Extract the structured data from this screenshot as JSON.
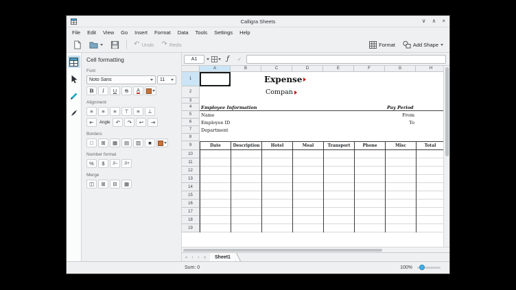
{
  "titlebar": {
    "title": "Calligra Sheets",
    "minimize": "∨",
    "maximize": "∧",
    "close": "×"
  },
  "menu": {
    "items": [
      "File",
      "Edit",
      "View",
      "Go",
      "Insert",
      "Format",
      "Data",
      "Tools",
      "Settings",
      "Help"
    ]
  },
  "toolbar": {
    "undo": "Undo",
    "redo": "Redo",
    "undo_icon": "↶",
    "redo_icon": "↷",
    "format": "Format",
    "add_shape": "Add Shape"
  },
  "panel": {
    "title": "Cell formatting",
    "font_label": "Font",
    "font_family": "Noto Sans",
    "font_size": "11",
    "bold": "B",
    "italic": "I",
    "underline": "U",
    "strike": "S",
    "font_color": "A",
    "alignment_label": "Alignment",
    "align_left": "≡",
    "align_center": "≡",
    "align_right": "≡",
    "align_top": "⊤",
    "align_middle": "≡",
    "align_bottom": "⊥",
    "indent_less": "⇤",
    "indent_more": "⇥",
    "angle_label": "Angle",
    "rotate_ccw": "↶",
    "rotate_cw": "↷",
    "wrap": "↩",
    "borders_label": "Borders",
    "border_icons": [
      "□",
      "⊞",
      "▦",
      "▤",
      "▥",
      "■"
    ],
    "number_label": "Number format",
    "percent": "%",
    "money": "$",
    "precision_less": ".0−",
    "precision_more": ".0+",
    "merge_label": "Merge",
    "merge_icons": [
      "◫",
      "⊞",
      "⊟",
      "▦"
    ]
  },
  "formula_bar": {
    "cell_ref": "A1",
    "fx": "ƒ",
    "apply": "✓"
  },
  "grid": {
    "columns": [
      "A",
      "B",
      "C",
      "D",
      "E",
      "F",
      "G",
      "H"
    ],
    "rows": [
      "1",
      "2",
      "3",
      "4",
      "5",
      "6",
      "7",
      "8",
      "9",
      "10",
      "11",
      "12",
      "13",
      "14",
      "15",
      "16",
      "17",
      "18",
      "19"
    ],
    "content": {
      "title": "Expense",
      "subtitle": "Compan",
      "employee_information": "Employee Information",
      "pay_period": "Pay Period",
      "name": "Name",
      "from": "From",
      "employee_id": "Employee ID",
      "to": "To",
      "department": "Department",
      "table_headers": [
        "Date",
        "Description",
        "Hotel",
        "Meal",
        "Transport",
        "Phone",
        "Misc",
        "Total"
      ]
    }
  },
  "tabbar": {
    "nav": [
      "«",
      "‹",
      "›",
      "»"
    ],
    "sheet_tab": "Sheet1"
  },
  "statusbar": {
    "sum": "Sum: 0",
    "zoom_level": "100%"
  },
  "colors": {
    "accent": "#3daee9",
    "selected_header": "#cbe5f6",
    "overflow_marker": "#cc1111",
    "swatch": "#c87137"
  }
}
